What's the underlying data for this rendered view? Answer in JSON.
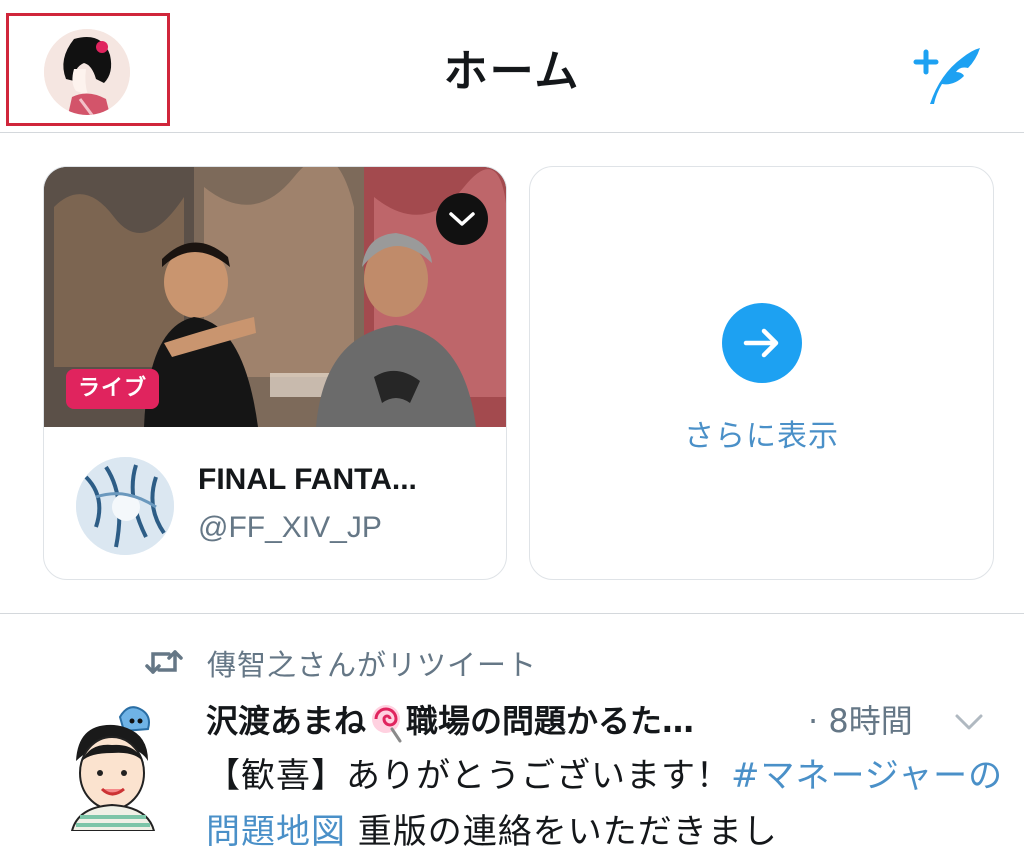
{
  "header": {
    "title": "ホーム",
    "profile_icon": "user-avatar-icon",
    "compose_icon": "compose-tweet-icon"
  },
  "live_card": {
    "badge": "ライブ",
    "channel_name": "FINAL FANTA...",
    "channel_handle": "@FF_XIV_JP",
    "dismiss_icon": "chevron-down-icon"
  },
  "more_card": {
    "label": "さらに表示",
    "icon": "arrow-right-icon"
  },
  "tweet": {
    "retweet_context": "傳智之さんがリツイート",
    "author_prefix": "沢渡あまね",
    "author_emoji": "lollipop-icon",
    "author_suffix": "職場の問題かるた…",
    "time": "· 8時間",
    "body_part1": "【歓喜】ありがとうございます！",
    "hashtag": "#マネージャーの問題地図",
    "body_part2": " 重版の連絡をいただきまし"
  },
  "colors": {
    "accent": "#1da1f2",
    "link": "#4a90c8",
    "live": "#e0245e",
    "highlight_box": "#d0263b",
    "secondary_text": "#657786"
  }
}
